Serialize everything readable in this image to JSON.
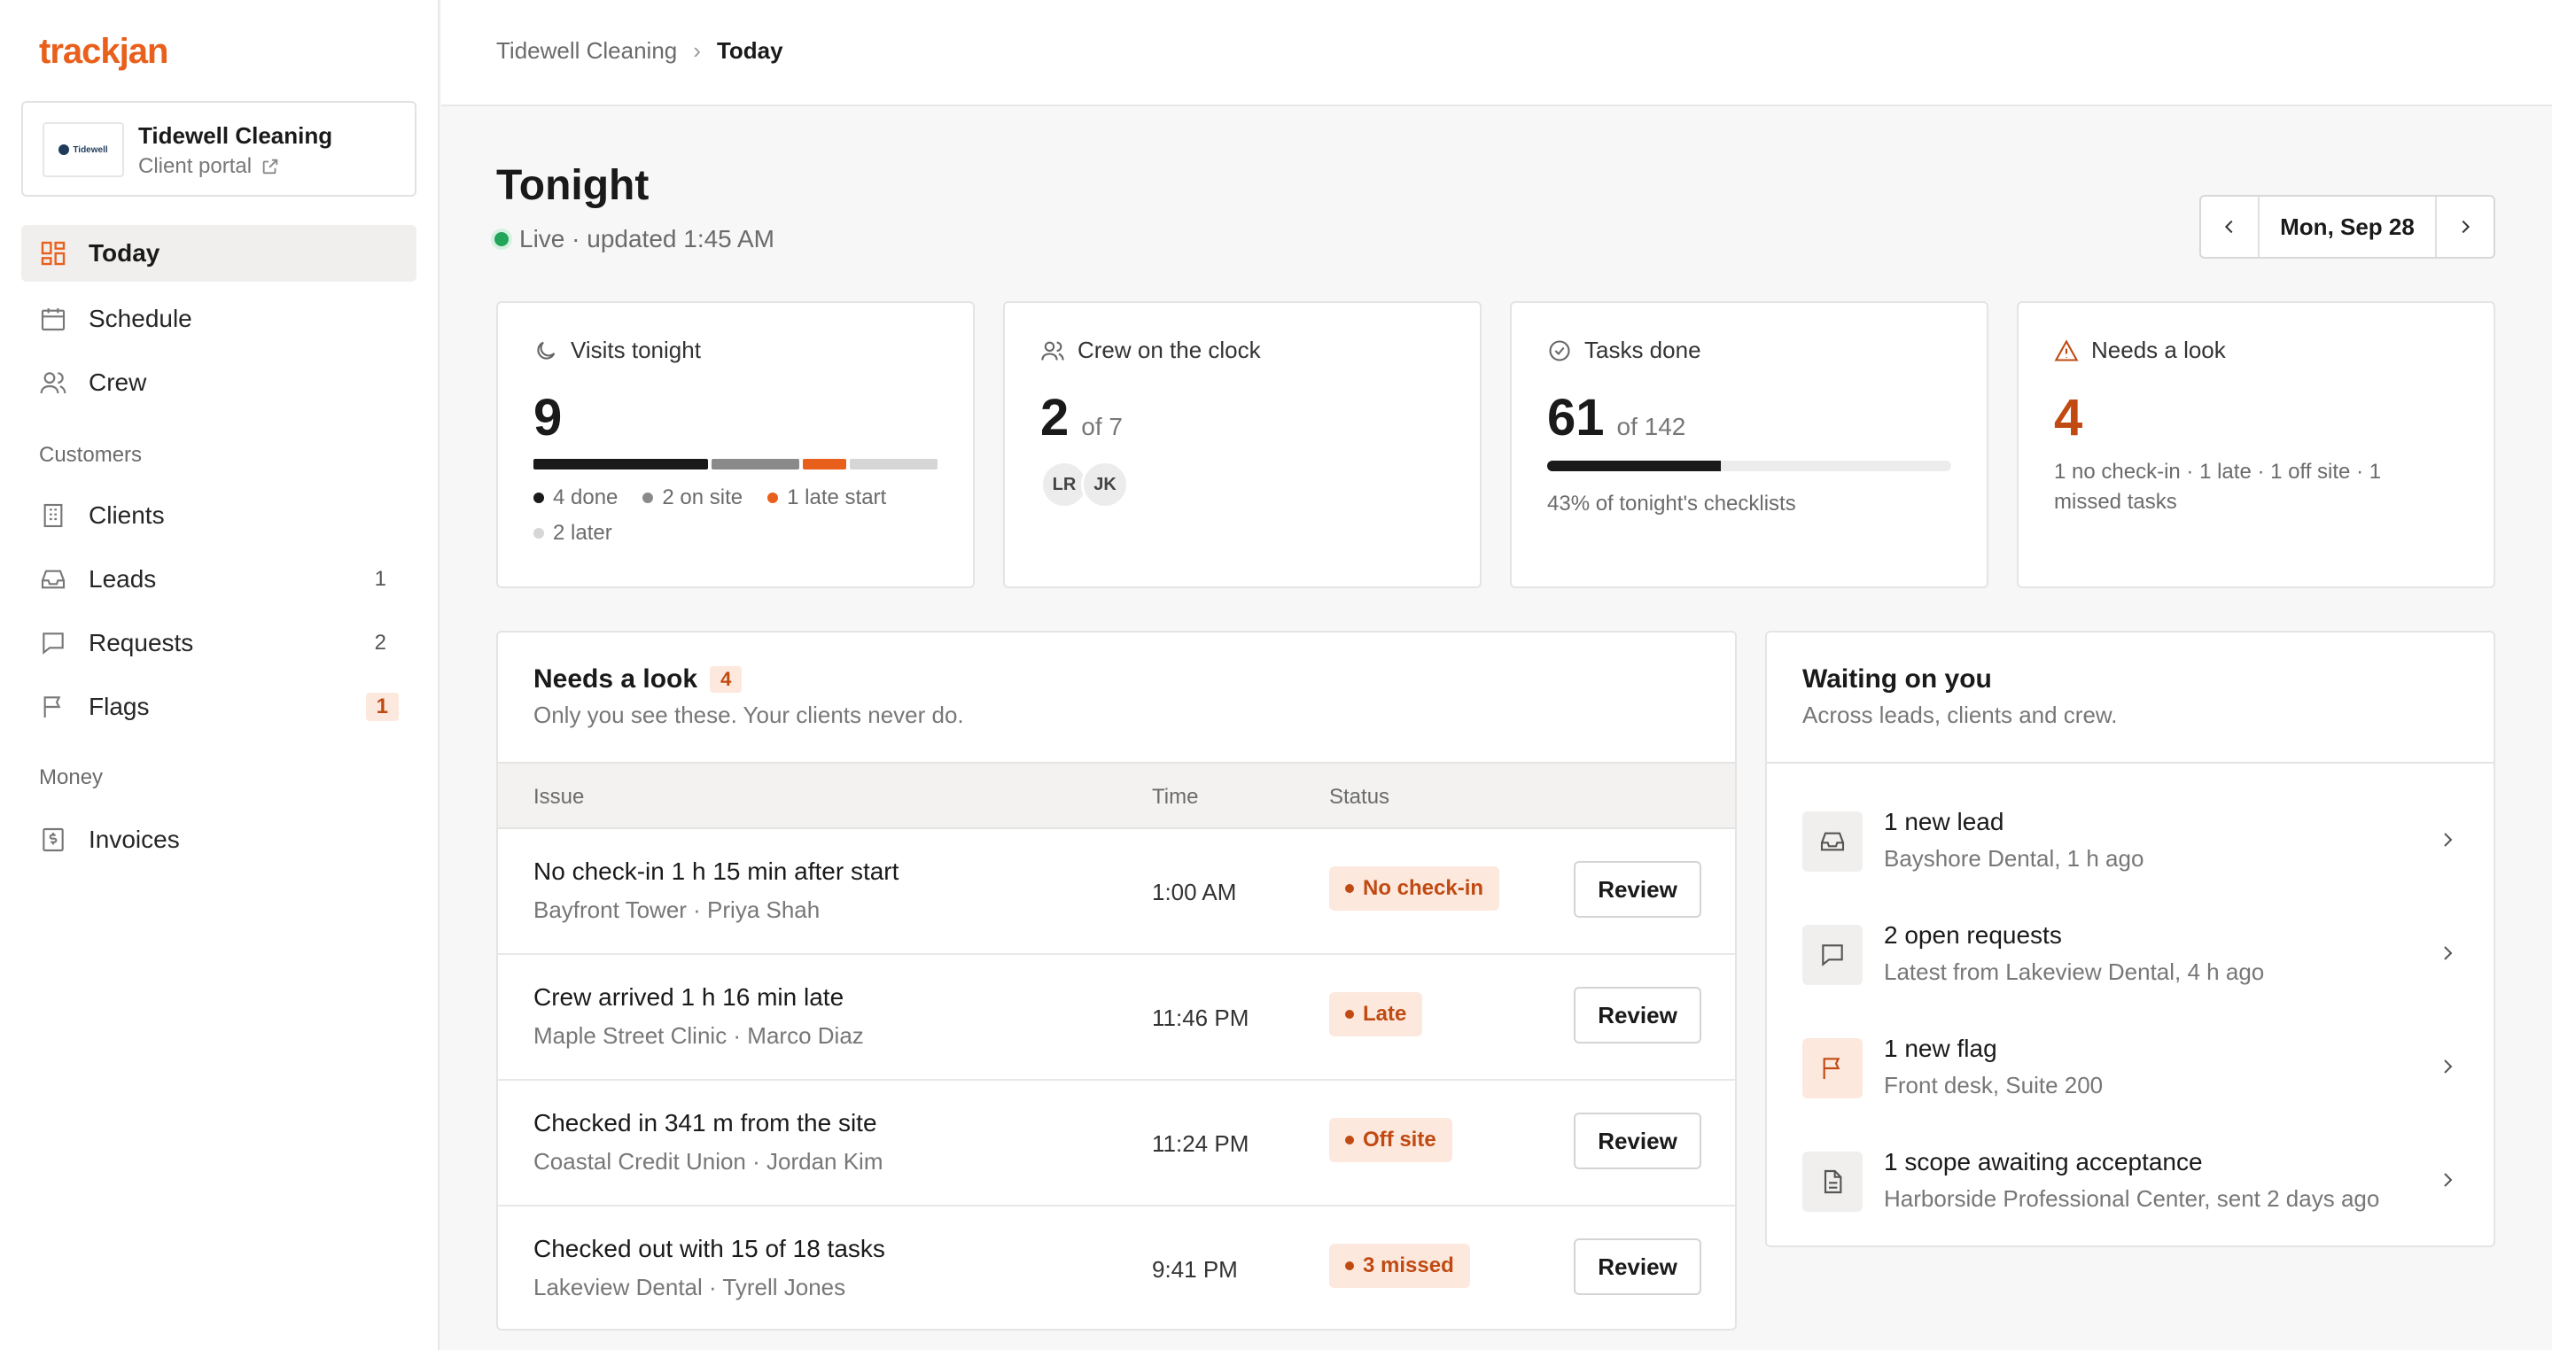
{
  "brand": {
    "logo": "trackjan",
    "accent": "#e8601c"
  },
  "org": {
    "name": "Tidewell Cleaning",
    "portal_label": "Client portal",
    "logo_text": "Tidewell"
  },
  "nav": {
    "primary": [
      {
        "label": "Today",
        "icon": "grid-icon",
        "active": true
      },
      {
        "label": "Schedule",
        "icon": "calendar-icon"
      },
      {
        "label": "Crew",
        "icon": "users-icon"
      }
    ],
    "customers_heading": "Customers",
    "customers": [
      {
        "label": "Clients",
        "icon": "building-icon",
        "count": ""
      },
      {
        "label": "Leads",
        "icon": "inbox-icon",
        "count": "1"
      },
      {
        "label": "Requests",
        "icon": "message-icon",
        "count": "2"
      },
      {
        "label": "Flags",
        "icon": "flag-icon",
        "count": "1"
      }
    ],
    "money_heading": "Money",
    "money": [
      {
        "label": "Invoices",
        "icon": "dollar-doc-icon"
      }
    ]
  },
  "breadcrumb": {
    "parent": "Tidewell Cleaning",
    "separator": "›",
    "current": "Today"
  },
  "header": {
    "title": "Tonight",
    "live_text": "Live · updated 1:45 AM",
    "live_color": "#22a559"
  },
  "date_picker": {
    "value": "Mon, Sep 28"
  },
  "stats": {
    "visits": {
      "label": "Visits tonight",
      "value": "9",
      "segments": [
        {
          "label": "4 done",
          "count": 4,
          "color": "#1a1a1a"
        },
        {
          "label": "2 on site",
          "count": 2,
          "color": "#8a8a8a"
        },
        {
          "label": "1 late start",
          "count": 1,
          "color": "#e8601c"
        },
        {
          "label": "2 later",
          "count": 2,
          "color": "#d6d6d6"
        }
      ]
    },
    "crew": {
      "label": "Crew on the clock",
      "value": "2",
      "of": "of 7",
      "avatars": [
        "LR",
        "JK"
      ]
    },
    "tasks": {
      "label": "Tasks done",
      "value": "61",
      "of": "of 142",
      "progress": 0.43,
      "note": "43% of tonight's checklists"
    },
    "needs": {
      "label": "Needs a look",
      "value": "4",
      "note": "1 no check-in · 1 late · 1 off site · 1 missed tasks"
    }
  },
  "needs_panel": {
    "title": "Needs a look",
    "badge": "4",
    "subtitle": "Only you see these. Your clients never do.",
    "columns": [
      "Issue",
      "Time",
      "Status"
    ],
    "review_label": "Review",
    "rows": [
      {
        "issue": "No check-in 1 h 15 min after start",
        "sub": "Bayfront Tower · Priya Shah",
        "time": "1:00 AM",
        "status": "No check-in"
      },
      {
        "issue": "Crew arrived 1 h 16 min late",
        "sub": "Maple Street Clinic · Marco Diaz",
        "time": "11:46 PM",
        "status": "Late"
      },
      {
        "issue": "Checked in 341 m from the site",
        "sub": "Coastal Credit Union · Jordan Kim",
        "time": "11:24 PM",
        "status": "Off site"
      },
      {
        "issue": "Checked out with 15 of 18 tasks",
        "sub": "Lakeview Dental · Tyrell Jones",
        "time": "9:41 PM",
        "status": "3 missed"
      }
    ]
  },
  "waiting_panel": {
    "title": "Waiting on you",
    "subtitle": "Across leads, clients and crew.",
    "items": [
      {
        "icon": "inbox-icon",
        "title": "1 new lead",
        "sub": "Bayshore Dental, 1 h ago"
      },
      {
        "icon": "message-icon",
        "title": "2 open requests",
        "sub": "Latest from Lakeview Dental, 4 h ago"
      },
      {
        "icon": "flag-icon",
        "title": "1 new flag",
        "sub": "Front desk, Suite 200"
      },
      {
        "icon": "document-icon",
        "title": "1 scope awaiting acceptance",
        "sub": "Harborside Professional Center, sent 2 days ago"
      }
    ]
  }
}
